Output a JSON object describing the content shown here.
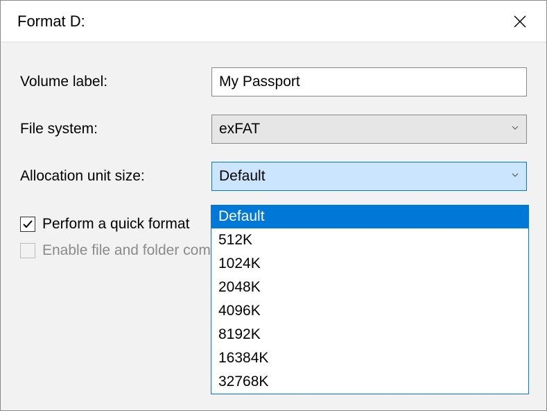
{
  "titlebar": {
    "title": "Format D:"
  },
  "form": {
    "volume_label_label": "Volume label:",
    "volume_label_value": "My Passport",
    "file_system_label": "File system:",
    "file_system_value": "exFAT",
    "allocation_label": "Allocation unit size:",
    "allocation_value": "Default",
    "allocation_options": [
      "Default",
      "512K",
      "1024K",
      "2048K",
      "4096K",
      "8192K",
      "16384K",
      "32768K"
    ]
  },
  "checkboxes": {
    "quick_format_label": "Perform a quick format",
    "quick_format_checked": true,
    "compression_label": "Enable file and folder compression",
    "compression_checked": false,
    "compression_enabled": false
  }
}
